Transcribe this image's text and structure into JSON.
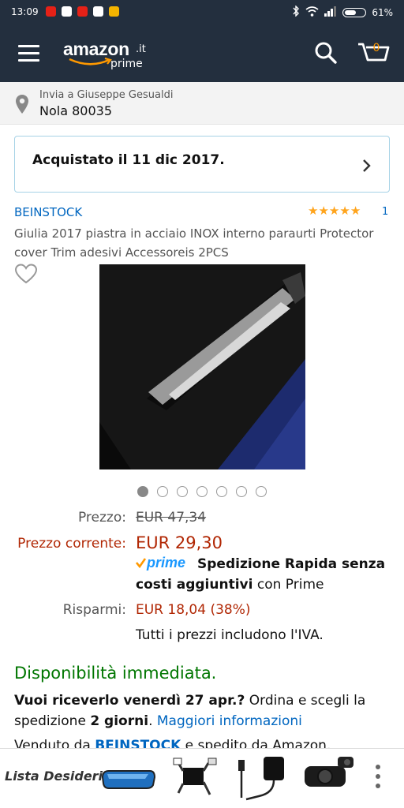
{
  "status_bar": {
    "time": "13:09",
    "battery_pct": "61%",
    "battery_level": 0.61
  },
  "header": {
    "logo_word": "amazon",
    "logo_tld": ".it",
    "logo_sub": "prime",
    "cart_count": "0",
    "brand_color": "#232f3e",
    "accent_color": "#ff9900"
  },
  "delivery": {
    "line1": "Invia a Giuseppe Gesualdi",
    "line2": "Nola 80035"
  },
  "order": {
    "purchased_text": "Acquistato il 11 dic 2017."
  },
  "product": {
    "brand": "BEINSTOCK",
    "rating_stars": 5,
    "review_count": "1",
    "title": "Giulia 2017 piastra in acciaio INOX interno paraurti Protector cover Trim adesivi Accessoreis 2PCS",
    "image_count": 7,
    "active_image": 0
  },
  "pricing": {
    "price_label": "Prezzo:",
    "price_old": "EUR 47,34",
    "current_label": "Prezzo corrente:",
    "price_current": "EUR 29,30",
    "prime_label": "prime",
    "shipping_bold": "Spedizione Rapida senza costi aggiuntivi",
    "shipping_rest": " con Prime",
    "savings_label": "Risparmi:",
    "savings_value": "EUR 18,04 (38%)",
    "vat_note": "Tutti i prezzi includono l'IVA."
  },
  "availability": {
    "status": "Disponibilità immediata.",
    "q_bold": "Vuoi riceverlo venerdì 27 apr.?",
    "q_rest1": " Ordina e scegli la spedizione ",
    "q_days": "2 giorni",
    "q_rest2": ". ",
    "more_info": "Maggiori informazioni",
    "sold_pre": "Venduto da ",
    "sold_by": "BEINSTOCK",
    "sold_post": " e spedito da Amazon."
  },
  "wishlist": {
    "label": "Lista Desideri"
  }
}
